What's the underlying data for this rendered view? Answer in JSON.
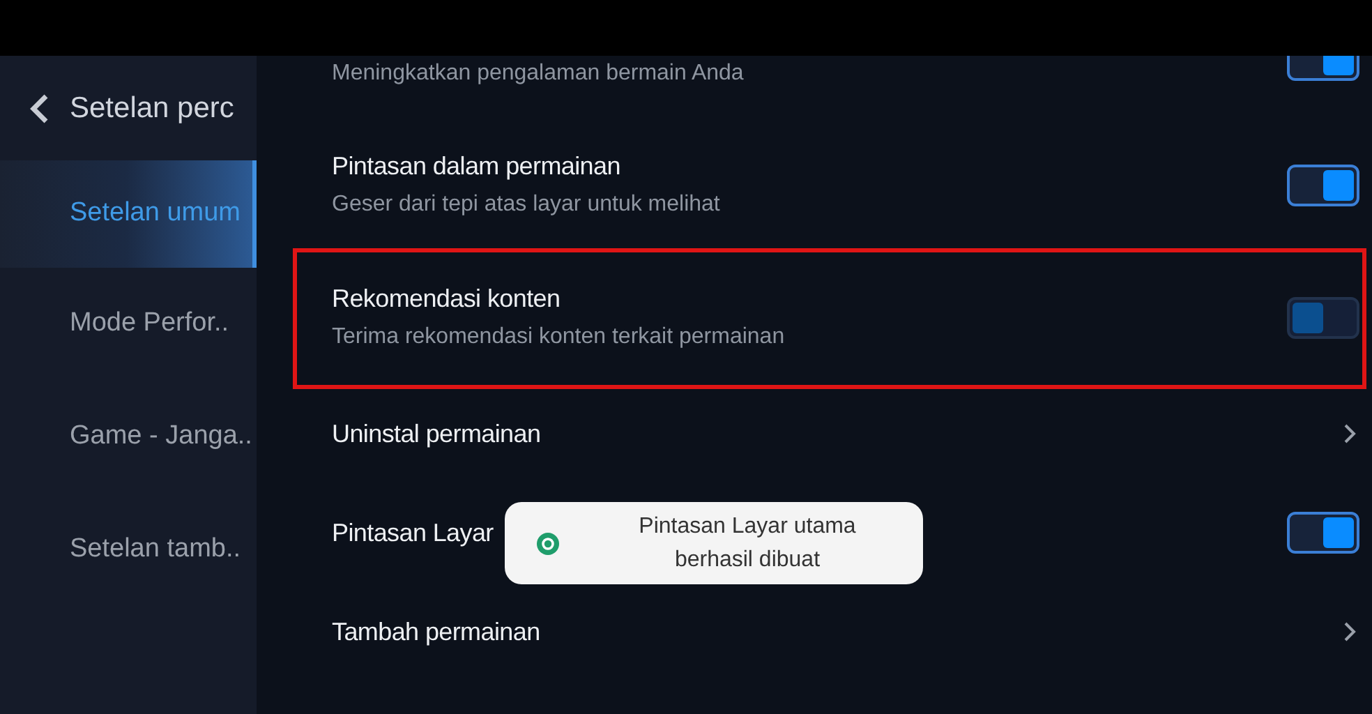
{
  "sidebar": {
    "title": "Setelan perc",
    "items": [
      {
        "label": "Setelan umum",
        "selected": true
      },
      {
        "label": "Mode Perfor..",
        "selected": false
      },
      {
        "label": "Game - Janga..",
        "selected": false
      },
      {
        "label": "Setelan tamb..",
        "selected": false
      }
    ]
  },
  "settings": [
    {
      "kind": "toggle",
      "description": "Meningkatkan pengalaman bermain Anda",
      "on": true,
      "highlighted": false
    },
    {
      "kind": "toggle",
      "label": "Pintasan dalam permainan",
      "description": "Geser dari tepi atas layar untuk melihat",
      "on": true,
      "highlighted": false
    },
    {
      "kind": "toggle",
      "label": "Rekomendasi konten",
      "description": "Terima rekomendasi konten terkait permainan",
      "on": false,
      "highlighted": true
    },
    {
      "kind": "link",
      "label": "Uninstal permainan",
      "highlighted": false
    },
    {
      "kind": "toggle",
      "label": "Pintasan Layar",
      "on": true,
      "highlighted": false
    },
    {
      "kind": "link",
      "label": "Tambah permainan",
      "highlighted": false
    }
  ],
  "toast": {
    "message": "Pintasan Layar utama berhasil dibuat"
  }
}
